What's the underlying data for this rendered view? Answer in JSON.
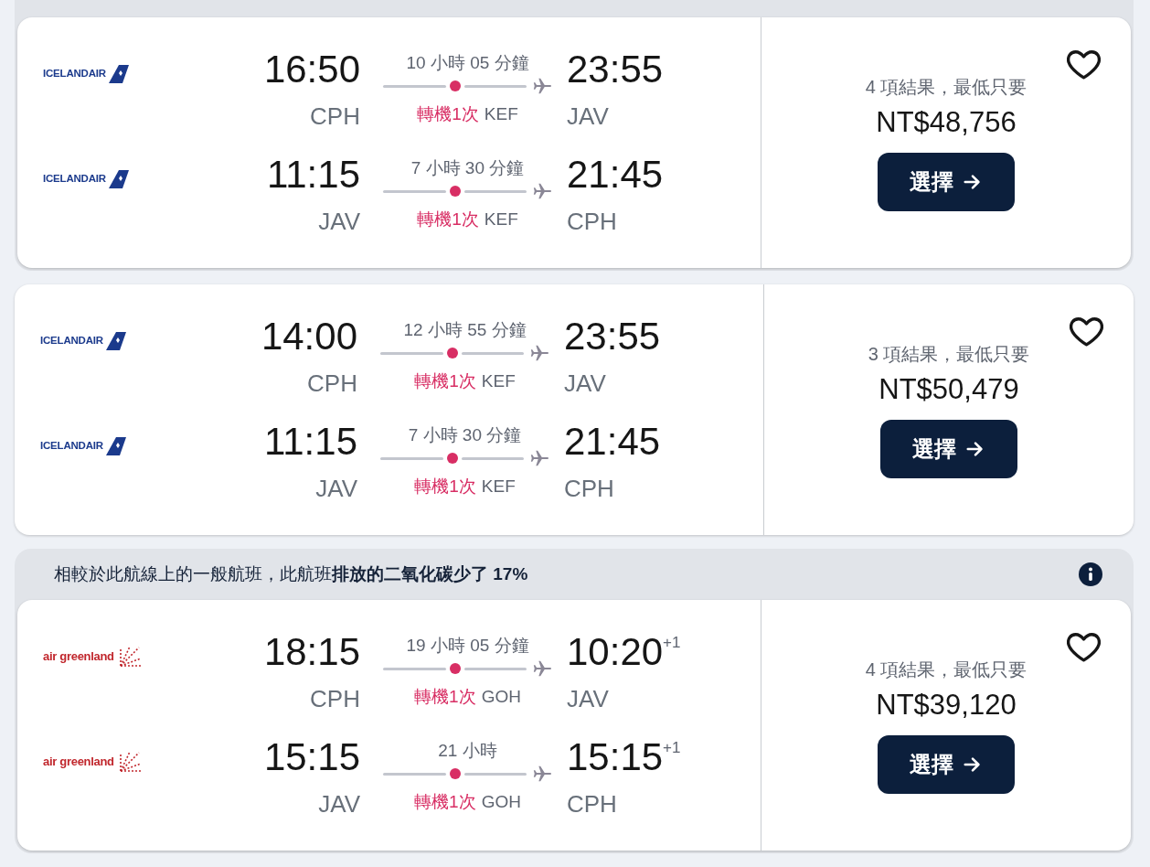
{
  "results": [
    {
      "highlighted": true,
      "legs": [
        {
          "airline": {
            "kind": "tail",
            "name": "ICELANDAIR"
          },
          "depart_time": "16:50",
          "depart_airport": "CPH",
          "duration": "10 小時 05 分鐘",
          "stops": "轉機1次",
          "via": "KEF",
          "arrive_time": "23:55",
          "arrive_airport": "JAV"
        },
        {
          "airline": {
            "kind": "tail",
            "name": "ICELANDAIR"
          },
          "depart_time": "11:15",
          "depart_airport": "JAV",
          "duration": "7 小時 30 分鐘",
          "stops": "轉機1次",
          "via": "KEF",
          "arrive_time": "21:45",
          "arrive_airport": "CPH"
        }
      ],
      "summary": "4 項結果，最低只要",
      "price": "NT$48,756",
      "select_label": "選擇",
      "saved": false
    },
    {
      "highlighted": false,
      "legs": [
        {
          "airline": {
            "kind": "tail",
            "name": "ICELANDAIR"
          },
          "depart_time": "14:00",
          "depart_airport": "CPH",
          "duration": "12 小時 55 分鐘",
          "stops": "轉機1次",
          "via": "KEF",
          "arrive_time": "23:55",
          "arrive_airport": "JAV"
        },
        {
          "airline": {
            "kind": "tail",
            "name": "ICELANDAIR"
          },
          "depart_time": "11:15",
          "depart_airport": "JAV",
          "duration": "7 小時 30 分鐘",
          "stops": "轉機1次",
          "via": "KEF",
          "arrive_time": "21:45",
          "arrive_airport": "CPH"
        }
      ],
      "summary": "3 項結果，最低只要",
      "price": "NT$50,479",
      "select_label": "選擇",
      "saved": false
    },
    {
      "highlighted": true,
      "note": "相較於此航線上的一般航班，此航班**排放的二氧化碳少了 17%**",
      "legs": [
        {
          "airline": {
            "kind": "burst",
            "name": "air greenland"
          },
          "depart_time": "18:15",
          "depart_airport": "CPH",
          "duration": "19 小時 05 分鐘",
          "stops": "轉機1次",
          "via": "GOH",
          "arrive_time": "10:20",
          "day_offset": "+1",
          "arrive_airport": "JAV"
        },
        {
          "airline": {
            "kind": "burst",
            "name": "air greenland"
          },
          "depart_time": "15:15",
          "depart_airport": "JAV",
          "duration": "21 小時",
          "stops": "轉機1次",
          "via": "GOH",
          "arrive_time": "15:15",
          "day_offset": "+1",
          "arrive_airport": "CPH"
        }
      ],
      "summary": "4 項結果，最低只要",
      "price": "NT$39,120",
      "select_label": "選擇",
      "saved": false
    }
  ]
}
